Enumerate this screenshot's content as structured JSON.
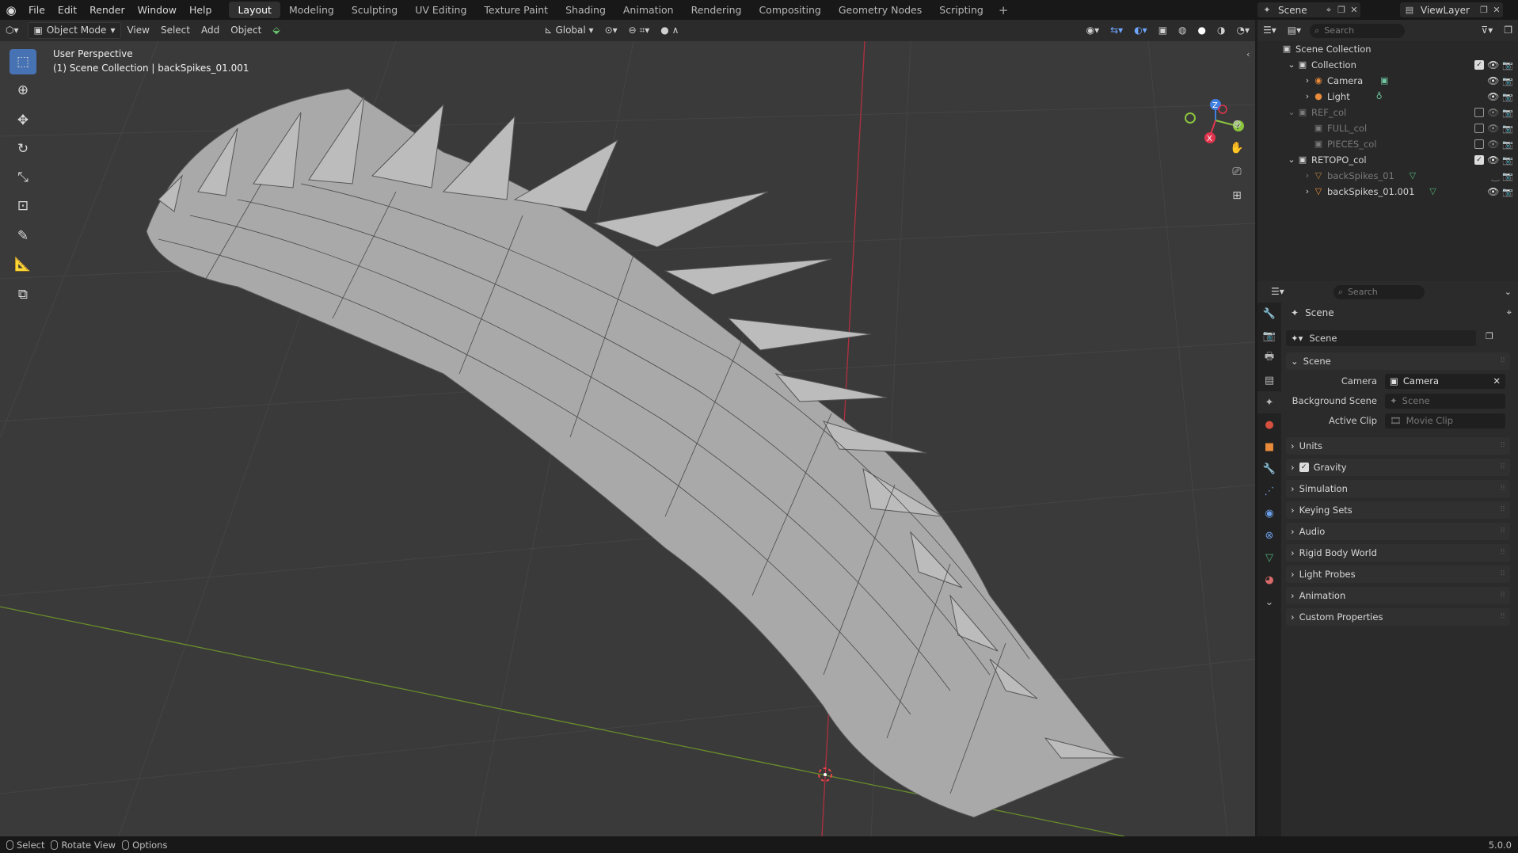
{
  "topbar": {
    "menus": [
      "File",
      "Edit",
      "Render",
      "Window",
      "Help"
    ],
    "workspaces": [
      "Layout",
      "Modeling",
      "Sculpting",
      "UV Editing",
      "Texture Paint",
      "Shading",
      "Animation",
      "Rendering",
      "Compositing",
      "Geometry Nodes",
      "Scripting"
    ],
    "active_workspace": "Layout",
    "scene_name": "Scene",
    "view_layer": "ViewLayer"
  },
  "viewport_header": {
    "mode": "Object Mode",
    "menus": [
      "View",
      "Select",
      "Add",
      "Object"
    ],
    "transform_orientation": "Global"
  },
  "viewport": {
    "perspective_label": "User Perspective",
    "collection_label": "(1) Scene Collection | backSpikes_01.001",
    "gizmo_axes": [
      "Z",
      "Y",
      "X"
    ],
    "axis_colors": {
      "x": "#e0354d",
      "y": "#8ac43e",
      "z": "#3f7fe0"
    }
  },
  "toolbar": {
    "tools": [
      "select-box-icon",
      "cursor-icon",
      "move-icon",
      "rotate-icon",
      "scale-icon",
      "transform-icon",
      "annotate-icon",
      "measure-icon",
      "add-cube-icon"
    ]
  },
  "outliner": {
    "search_placeholder": "Search",
    "root": "Scene Collection",
    "items": [
      {
        "label": "Collection",
        "indent": 1,
        "type": "collection",
        "checked": true,
        "visible": true
      },
      {
        "label": "Camera",
        "indent": 2,
        "type": "camera",
        "visible": true
      },
      {
        "label": "Light",
        "indent": 2,
        "type": "light",
        "visible": true
      },
      {
        "label": "REF_col",
        "indent": 1,
        "type": "collection",
        "checked": false,
        "visible": false
      },
      {
        "label": "FULL_col",
        "indent": 2,
        "type": "collection",
        "checked": false,
        "visible": false
      },
      {
        "label": "PIECES_col",
        "indent": 2,
        "type": "collection",
        "checked": false,
        "visible": false
      },
      {
        "label": "RETOPO_col",
        "indent": 1,
        "type": "collection",
        "checked": true,
        "visible": true
      },
      {
        "label": "backSpikes_01",
        "indent": 2,
        "type": "mesh",
        "visible": false
      },
      {
        "label": "backSpikes_01.001",
        "indent": 2,
        "type": "mesh",
        "visible": true
      }
    ]
  },
  "properties": {
    "search_placeholder": "Search",
    "context_title": "Scene",
    "datablock": "Scene",
    "scene_panel": "Scene",
    "fields": [
      {
        "label": "Camera",
        "value": "Camera",
        "placeholder": false
      },
      {
        "label": "Background Scene",
        "value": "Scene",
        "placeholder": true
      },
      {
        "label": "Active Clip",
        "value": "Movie Clip",
        "placeholder": true
      }
    ],
    "panels": [
      "Units",
      "Gravity",
      "Simulation",
      "Keying Sets",
      "Audio",
      "Rigid Body World",
      "Light Probes",
      "Animation",
      "Custom Properties"
    ],
    "gravity_checked": true
  },
  "statusbar": {
    "items": [
      "Select",
      "Rotate View",
      "Options"
    ],
    "version": "5.0.0"
  }
}
